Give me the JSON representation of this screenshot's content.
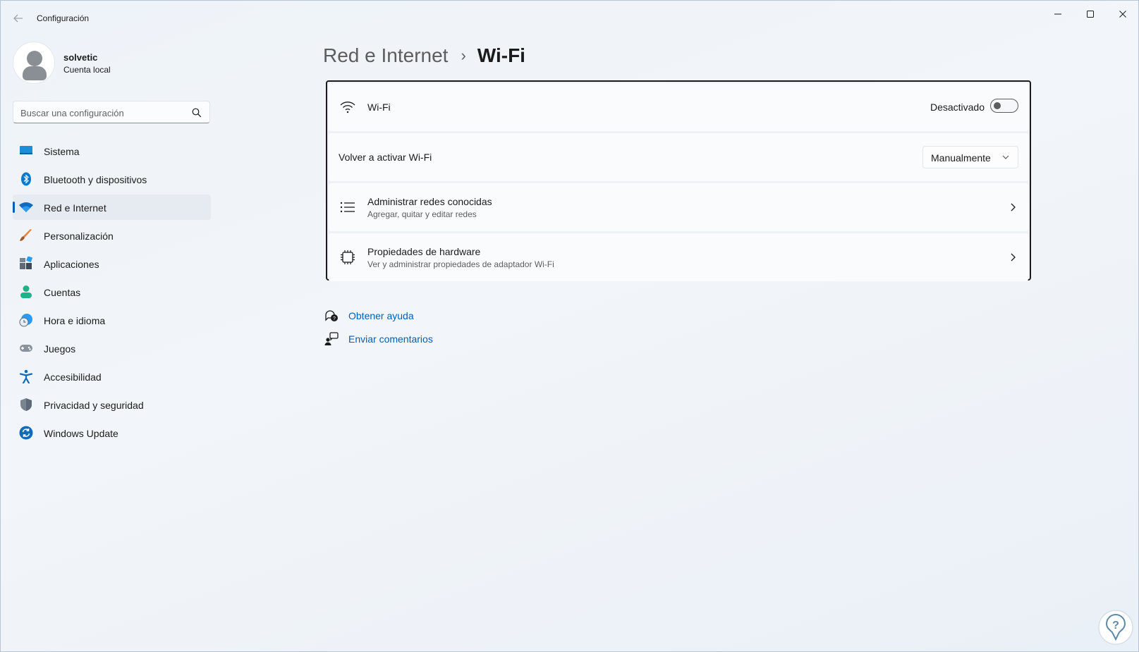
{
  "window": {
    "title": "Configuración"
  },
  "profile": {
    "name": "solvetic",
    "account_type": "Cuenta local"
  },
  "search": {
    "placeholder": "Buscar una configuración",
    "value": ""
  },
  "sidebar": {
    "items": [
      {
        "label": "Sistema",
        "icon": "monitor-icon",
        "selected": false
      },
      {
        "label": "Bluetooth y dispositivos",
        "icon": "bluetooth-icon",
        "selected": false
      },
      {
        "label": "Red e Internet",
        "icon": "wifi-icon",
        "selected": true
      },
      {
        "label": "Personalización",
        "icon": "brush-icon",
        "selected": false
      },
      {
        "label": "Aplicaciones",
        "icon": "apps-icon",
        "selected": false
      },
      {
        "label": "Cuentas",
        "icon": "person-icon",
        "selected": false
      },
      {
        "label": "Hora e idioma",
        "icon": "clock-globe-icon",
        "selected": false
      },
      {
        "label": "Juegos",
        "icon": "gamepad-icon",
        "selected": false
      },
      {
        "label": "Accesibilidad",
        "icon": "accessibility-icon",
        "selected": false
      },
      {
        "label": "Privacidad y seguridad",
        "icon": "shield-icon",
        "selected": false
      },
      {
        "label": "Windows Update",
        "icon": "update-icon",
        "selected": false
      }
    ]
  },
  "breadcrumb": {
    "parent": "Red e Internet",
    "separator": "›",
    "current": "Wi-Fi"
  },
  "wifi": {
    "toggle": {
      "title": "Wi-Fi",
      "state_label": "Desactivado",
      "on": false
    },
    "reactivate": {
      "title": "Volver a activar Wi-Fi",
      "selected": "Manualmente"
    },
    "known_networks": {
      "title": "Administrar redes conocidas",
      "subtitle": "Agregar, quitar y editar redes"
    },
    "hardware": {
      "title": "Propiedades de hardware",
      "subtitle": "Ver y administrar propiedades de adaptador Wi-Fi"
    }
  },
  "links": {
    "help": "Obtener ayuda",
    "feedback": "Enviar comentarios"
  },
  "colors": {
    "accent": "#005fb8",
    "background": "#eef3f9",
    "card": "#f9fbfd"
  }
}
